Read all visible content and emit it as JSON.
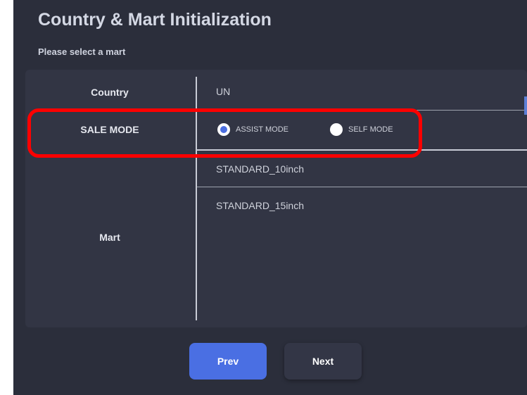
{
  "header": {
    "title": "Country & Mart Initialization",
    "subtitle": "Please select a mart"
  },
  "form": {
    "country": {
      "label": "Country",
      "value": "UN"
    },
    "sale_mode": {
      "label": "SALE MODE",
      "options": [
        {
          "label": "ASSIST MODE",
          "selected": true
        },
        {
          "label": "SELF MODE",
          "selected": false
        }
      ]
    },
    "mart": {
      "label": "Mart",
      "items": [
        "STANDARD_10inch",
        "STANDARD_15inch"
      ]
    }
  },
  "footer": {
    "prev_label": "Prev",
    "next_label": "Next"
  },
  "colors": {
    "background": "#2b2e3b",
    "panel": "#323544",
    "accent": "#4a6fe3",
    "highlight": "#ff0000"
  }
}
